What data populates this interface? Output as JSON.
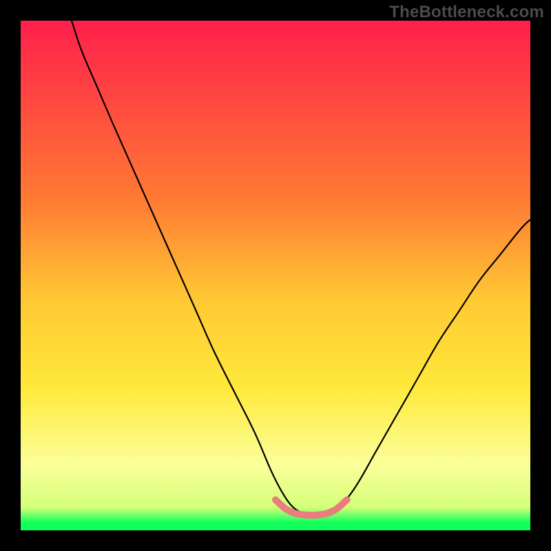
{
  "watermark": "TheBottleneck.com",
  "colors": {
    "black": "#000000",
    "curve": "#000000",
    "accent_pink": "#ea7d7d",
    "grad_top": "#ff1f4b",
    "grad_mid_orange": "#ffa436",
    "grad_yellow": "#ffe93a",
    "grad_light_yellow": "#fbff99",
    "grad_green": "#10ff5a",
    "watermark_color": "#4b4b4b"
  },
  "chart_data": {
    "type": "line",
    "title": "",
    "xlabel": "",
    "ylabel": "",
    "xlim": [
      0,
      100
    ],
    "ylim": [
      0,
      100
    ],
    "series": [
      {
        "name": "bottleneck-curve",
        "x": [
          10,
          12,
          15,
          18,
          22,
          26,
          30,
          34,
          38,
          42,
          46,
          49,
          51,
          53,
          55,
          57,
          59,
          61,
          63,
          66,
          70,
          74,
          78,
          82,
          86,
          90,
          94,
          98,
          100
        ],
        "values": [
          100,
          94,
          87,
          80,
          71,
          62,
          53,
          44,
          35,
          27,
          19,
          12,
          8,
          5,
          3.5,
          3,
          3,
          3.5,
          5,
          9,
          16,
          23,
          30,
          37,
          43,
          49,
          54,
          59,
          61
        ]
      },
      {
        "name": "bottleneck-flat-highlight",
        "x": [
          50,
          52,
          54,
          56,
          58,
          60,
          62,
          64
        ],
        "values": [
          6,
          4.2,
          3.3,
          3,
          3,
          3.3,
          4.2,
          6
        ]
      }
    ],
    "gradient_stops": [
      {
        "pos": 0.0,
        "color": "#ff1f4b"
      },
      {
        "pos": 0.35,
        "color": "#ff7a34"
      },
      {
        "pos": 0.55,
        "color": "#ffc933"
      },
      {
        "pos": 0.72,
        "color": "#ffe93a"
      },
      {
        "pos": 0.87,
        "color": "#fbff99"
      },
      {
        "pos": 0.955,
        "color": "#d4ff7a"
      },
      {
        "pos": 0.985,
        "color": "#10ff5a"
      },
      {
        "pos": 1.0,
        "color": "#10ff5a"
      }
    ]
  }
}
